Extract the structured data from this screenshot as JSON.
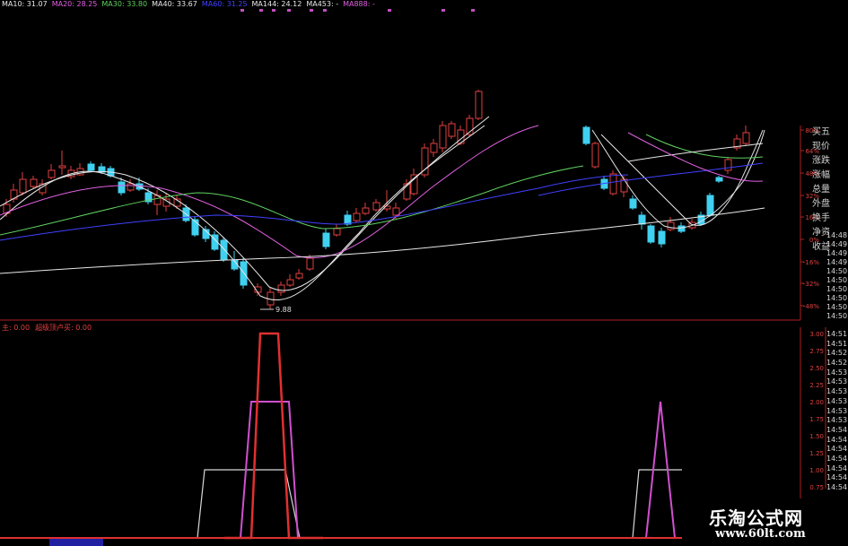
{
  "header": {
    "ma_items": [
      {
        "label": "MA10: 31.07",
        "color": "#e8e8e8"
      },
      {
        "label": "MA20: 28.25",
        "color": "#e060e0"
      },
      {
        "label": "MA30: 33.80",
        "color": "#60d060"
      },
      {
        "label": "MA40: 33.67",
        "color": "#e8e8e8"
      },
      {
        "label": "MA60: 31.25",
        "color": "#4040ff"
      },
      {
        "label": "MA144: 24.12",
        "color": "#e8e8e8"
      },
      {
        "label": "MA453: -",
        "color": "#e8e8e8"
      },
      {
        "label": "MA888: -",
        "color": "#e060e0"
      }
    ]
  },
  "sub_header": {
    "items": [
      {
        "label": "主: 0.00",
        "color": "#e04040"
      },
      {
        "label": "超级顶卢买: 0.00",
        "color": "#e04040"
      }
    ]
  },
  "side_panel": {
    "labels": [
      "买五",
      "现价",
      "涨跌",
      "涨幅",
      "总量",
      "外盘",
      "换手",
      "净资",
      "收益"
    ]
  },
  "pct_axis": {
    "ticks": [
      "80%",
      "64%",
      "48%",
      "32%",
      "16%",
      "0%",
      "-16%",
      "-32%",
      "-48%"
    ],
    "color": "#e04040"
  },
  "time_axis_upper": {
    "ticks": [
      "14:48",
      "14:49",
      "14:49",
      "14:49",
      "14:50",
      "14:50",
      "14:50",
      "14:50",
      "14:50",
      "14:50"
    ]
  },
  "time_axis_lower": {
    "ticks": [
      "14:51",
      "14:51",
      "14:52",
      "14:52",
      "14:53",
      "14:53",
      "14:53",
      "14:53",
      "14:53",
      "14:53",
      "14:54",
      "14:54",
      "14:54",
      "14:54",
      "14:54",
      "14:54",
      "14:54"
    ]
  },
  "low_annotation": "9.88",
  "watermark": {
    "title": "乐淘公式网",
    "url": "www.60lt.com"
  },
  "chart_data": [
    {
      "type": "candlestick",
      "title": "",
      "lines": [
        {
          "name": "MA10",
          "color": "#e8e8e8"
        },
        {
          "name": "MA20",
          "color": "#e060e0"
        },
        {
          "name": "MA30",
          "color": "#60d060"
        },
        {
          "name": "MA60",
          "color": "#4040ff"
        },
        {
          "name": "MA144",
          "color": "#e8e8e8"
        }
      ],
      "low_label": "9.88"
    },
    {
      "type": "line",
      "title": "",
      "ylim": [
        0,
        3.0
      ],
      "y_ticks": [
        0.75,
        1.0,
        1.25,
        1.5,
        1.75,
        2.0,
        2.25,
        2.5,
        2.75,
        3.0
      ],
      "series": [
        {
          "color": "#e03030",
          "values": [
            0,
            3.0,
            3.0,
            0,
            0
          ]
        },
        {
          "color": "#d050d0",
          "values": [
            0,
            2.0,
            2.0,
            0,
            0,
            2.0,
            0
          ]
        },
        {
          "color": "#d8d8d8",
          "values": [
            0,
            1.0,
            1.0,
            0,
            0,
            1.0,
            1.0,
            0
          ]
        }
      ]
    }
  ]
}
